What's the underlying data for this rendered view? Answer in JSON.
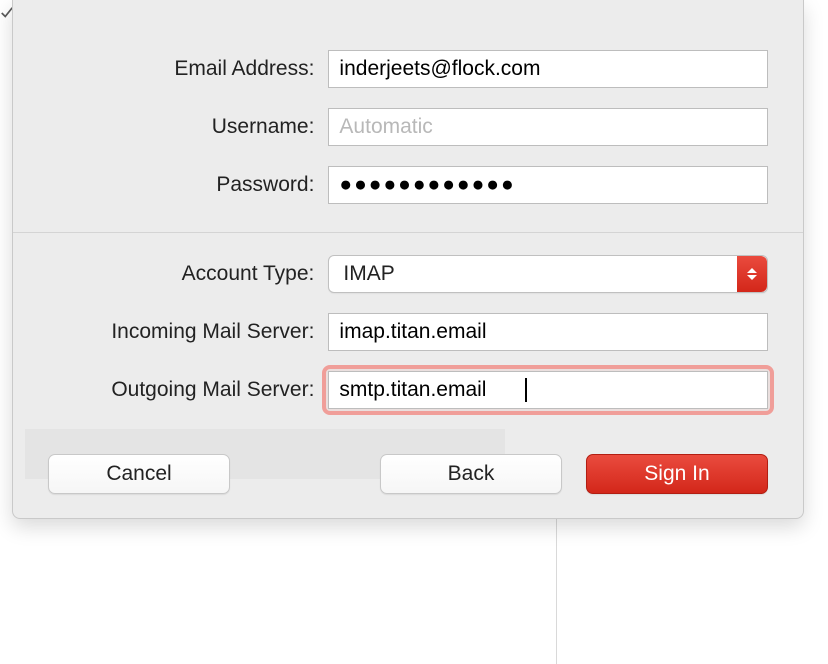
{
  "labels": {
    "email": "Email Address:",
    "username": "Username:",
    "password": "Password:",
    "account_type": "Account Type:",
    "incoming": "Incoming Mail Server:",
    "outgoing": "Outgoing Mail Server:"
  },
  "fields": {
    "email_value": "inderjeets@flock.com",
    "username_value": "",
    "username_placeholder": "Automatic",
    "password_mask": "●●●●●●●●●●●●",
    "account_type_value": "IMAP",
    "incoming_value": "imap.titan.email",
    "outgoing_value": "smtp.titan.email"
  },
  "buttons": {
    "cancel": "Cancel",
    "back": "Back",
    "signin": "Sign In"
  }
}
